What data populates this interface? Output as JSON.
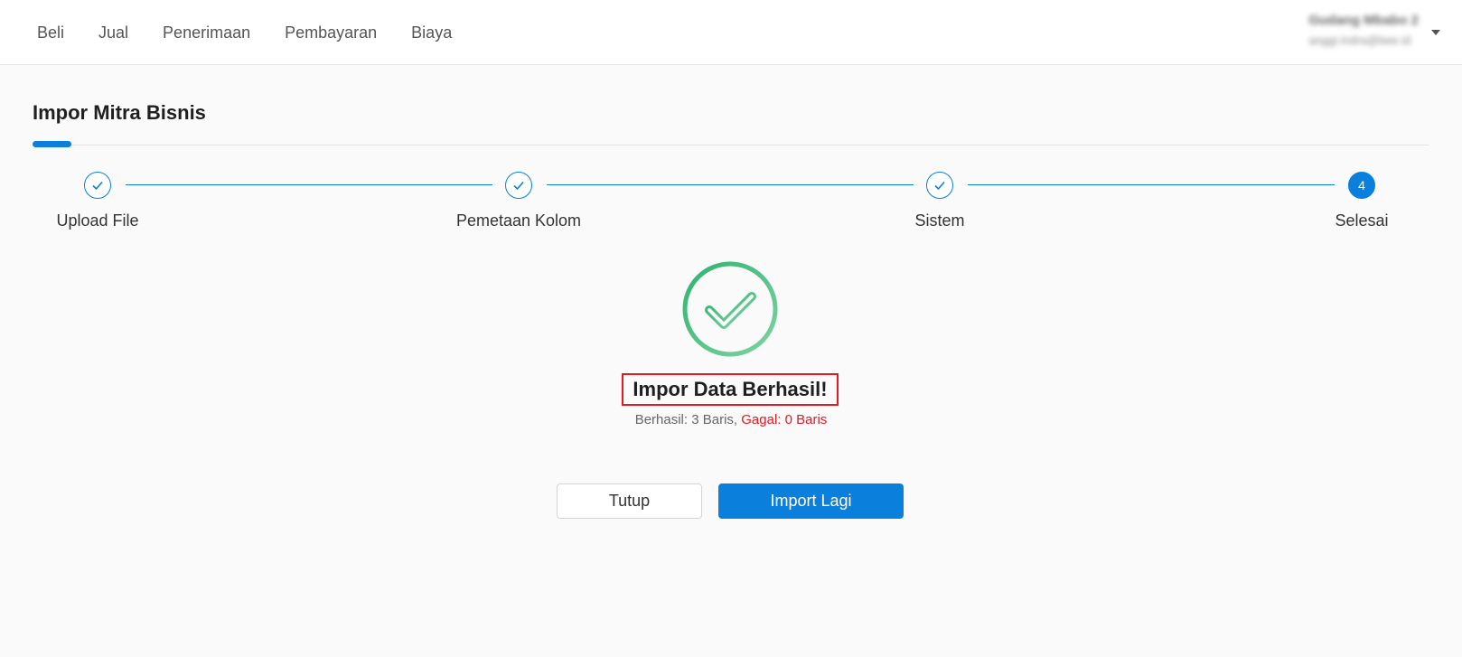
{
  "nav": {
    "items": [
      {
        "label": "Beli"
      },
      {
        "label": "Jual"
      },
      {
        "label": "Penerimaan"
      },
      {
        "label": "Pembayaran"
      },
      {
        "label": "Biaya"
      }
    ]
  },
  "account": {
    "name": "Gudang Mbabo 2",
    "email": "anggi.indra@bee.id"
  },
  "page": {
    "title": "Impor Mitra Bisnis"
  },
  "stepper": {
    "steps": [
      {
        "label": "Upload File",
        "status": "done"
      },
      {
        "label": "Pemetaan Kolom",
        "status": "done"
      },
      {
        "label": "Sistem",
        "status": "done"
      },
      {
        "label": "Selesai",
        "status": "active",
        "number": "4"
      }
    ]
  },
  "result": {
    "title": "Impor Data Berhasil!",
    "success_text": "Berhasil: 3 Baris,",
    "fail_text": "Gagal: 0 Baris"
  },
  "buttons": {
    "close_label": "Tutup",
    "import_again_label": "Import Lagi"
  },
  "colors": {
    "primary": "#0a7fdc",
    "success": "#3dbb7a",
    "danger": "#e01b24"
  }
}
